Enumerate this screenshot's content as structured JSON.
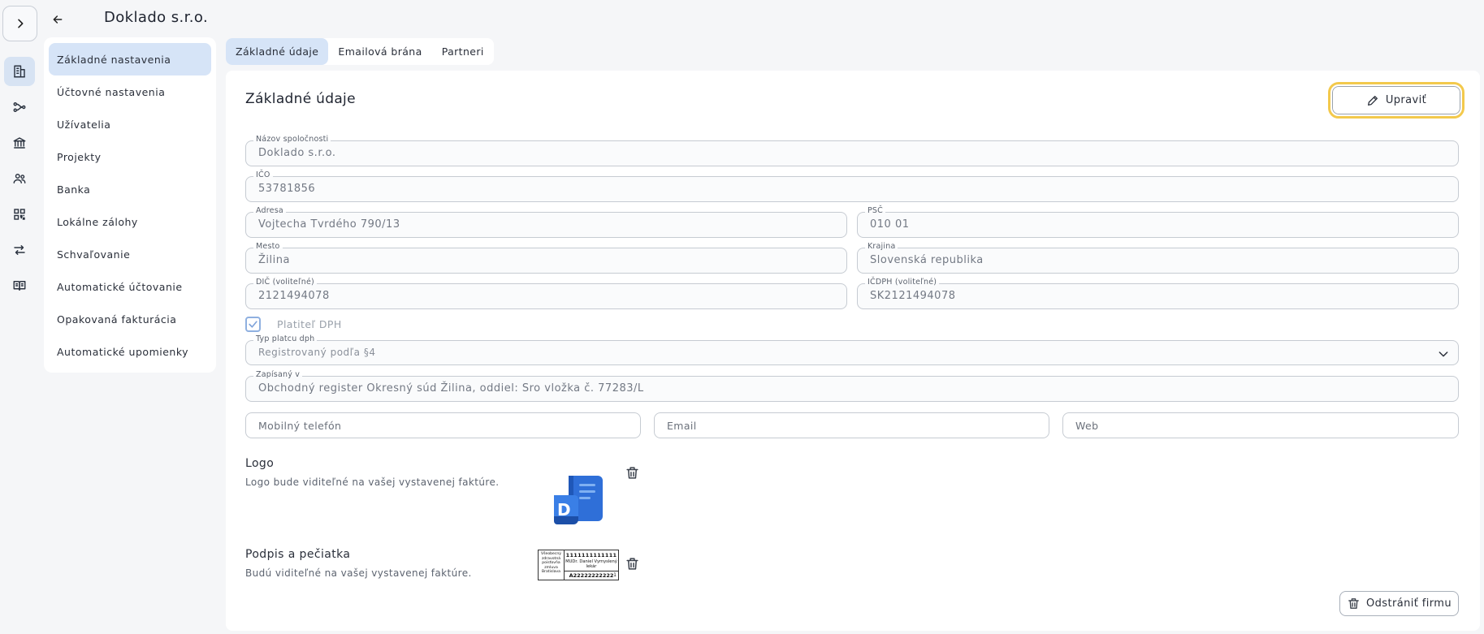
{
  "header": {
    "title": "Doklado s.r.o."
  },
  "settings_nav": {
    "items": [
      {
        "label": "Základné nastavenia",
        "active": true
      },
      {
        "label": "Účtovné nastavenia",
        "active": false
      },
      {
        "label": "Užívatelia",
        "active": false
      },
      {
        "label": "Projekty",
        "active": false
      },
      {
        "label": "Banka",
        "active": false
      },
      {
        "label": "Lokálne zálohy",
        "active": false
      },
      {
        "label": "Schvaľovanie",
        "active": false
      },
      {
        "label": "Automatické účtovanie",
        "active": false
      },
      {
        "label": "Opakovaná fakturácia",
        "active": false
      },
      {
        "label": "Automatické upomienky",
        "active": false
      }
    ]
  },
  "tabs": [
    {
      "label": "Základné údaje",
      "active": true
    },
    {
      "label": "Emailová brána",
      "active": false
    },
    {
      "label": "Partneri",
      "active": false
    }
  ],
  "card": {
    "title": "Základné údaje",
    "edit_label": "Upraviť"
  },
  "fields": {
    "company_name": {
      "label": "Názov spoločnosti",
      "value": "Doklado s.r.o."
    },
    "ico": {
      "label": "IČO",
      "value": "53781856"
    },
    "address": {
      "label": "Adresa",
      "value": "Vojtecha Tvrdého 790/13"
    },
    "psc": {
      "label": "PSČ",
      "value": "010 01"
    },
    "city": {
      "label": "Mesto",
      "value": "Žilina"
    },
    "country": {
      "label": "Krajina",
      "value": "Slovenská republika"
    },
    "dic": {
      "label": "DIČ (voliteľné)",
      "value": "2121494078"
    },
    "icdph": {
      "label": "IČDPH (voliteľné)",
      "value": "SK2121494078"
    },
    "vat_payer": {
      "label": "Platiteľ DPH",
      "checked": true
    },
    "vat_type": {
      "label": "Typ platcu dph",
      "value": "Registrovaný podľa §4"
    },
    "registered_in": {
      "label": "Zapísaný v",
      "value": "Obchodný register Okresný súd Žilina, oddiel: Sro vložka č. 77283/L"
    },
    "mobile": {
      "placeholder": "Mobilný telefón"
    },
    "email": {
      "placeholder": "Email"
    },
    "web": {
      "placeholder": "Web"
    }
  },
  "logo_section": {
    "title": "Logo",
    "description": "Logo bude viditeľné na vašej vystavenej faktúre.",
    "logo_letter": "D"
  },
  "signature_section": {
    "title": "Podpis a pečiatka",
    "description": "Budú viditeľné na vašej vystavenej faktúre.",
    "stamp": {
      "left_text": "Všeobecný zdravotná poisťovňa zmluva Bratislava",
      "number": "1111111111111",
      "name": "MUDr. Daniel Vymyslený lekár",
      "code": "A22222222222",
      "suffix": "1"
    }
  },
  "footer": {
    "delete_company_label": "Odstrániť firmu"
  },
  "colors": {
    "accent_bg": "#d6e4f7",
    "focus_ring": "#f3c94c",
    "logo_blue": "#2f6fd8"
  }
}
